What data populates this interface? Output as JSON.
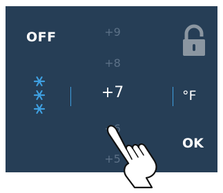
{
  "controls": {
    "off_label": "OFF",
    "ok_label": "OK",
    "unit_label": "°F"
  },
  "temperature_picker": {
    "values": [
      "+9",
      "+8",
      "+7",
      "+6",
      "+5"
    ],
    "current": "+7"
  },
  "icons": {
    "mode": "snowflake-icon",
    "lock": "lock-icon",
    "hand": "hand-pointer-icon"
  },
  "colors": {
    "panel": "#263e56",
    "accent": "#3f9fe0",
    "dim_text": "#5c7187",
    "text": "#ffffff"
  }
}
